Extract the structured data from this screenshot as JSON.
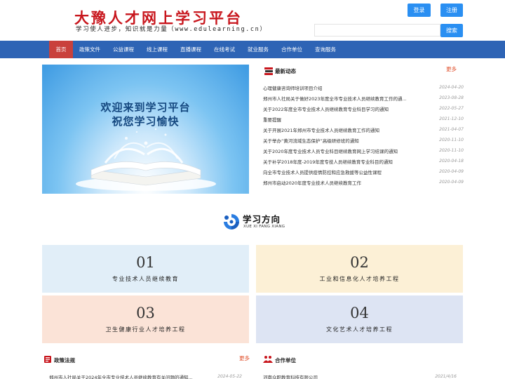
{
  "header": {
    "title": "大豫人才网上学习平台",
    "slogan": "学习使人进步，知识就是力量（www.edulearning.cn）",
    "login_label": "登录",
    "register_label": "注册",
    "search_placeholder": "",
    "search_label": "搜索"
  },
  "nav": {
    "items": [
      "首页",
      "政策文件",
      "公益课程",
      "线上课程",
      "直播课程",
      "在线考试",
      "就业服务",
      "合作单位",
      "查询服务"
    ],
    "active_index": 0
  },
  "banner": {
    "line1": "欢迎来到学习平台",
    "line2": "祝您学习愉快"
  },
  "news": {
    "title": "最新动态",
    "more_label": "更多",
    "items": [
      {
        "title": "心理健康咨询师培训项目介绍",
        "date": "2024-04-20"
      },
      {
        "title": "郑州市人社局关于做好2023年度全市专业技术人员继续教育工作的通...",
        "date": "2023-08-28"
      },
      {
        "title": "关于2022年度全市专业技术人员继续教育专业科目学习的通知",
        "date": "2022-05-27"
      },
      {
        "title": "重要提醒",
        "date": "2021-12-10"
      },
      {
        "title": "关于开展2021年郑州市专业技术人员继续教育工作的通知",
        "date": "2021-04-07"
      },
      {
        "title": "关于举办“黄河流域生态保护”高级研修班的通知",
        "date": "2020-11-10"
      },
      {
        "title": "关于2020年度专业技术人员专业科目继续教育网上学习结课的通知",
        "date": "2020-11-10"
      },
      {
        "title": "关于补学2018年度-2019年度专技人员继续教育专业科目的通知",
        "date": "2020-04-18"
      },
      {
        "title": "向全市专业技术人员提供疫情防控和应急救援等公益性课程",
        "date": "2020-04-09"
      },
      {
        "title": "郑州市启动2020年度专业技术人员继续教育工作",
        "date": "2020-04-09"
      }
    ]
  },
  "direction": {
    "title": "学习方向",
    "subtitle": "XUE XI FANG XIANG",
    "cards": [
      {
        "num": "01",
        "label": "专业技术人员继续教育",
        "color": "#e1eef8"
      },
      {
        "num": "02",
        "label": "工业和信息化人才培养工程",
        "color": "#fcf0d6"
      },
      {
        "num": "03",
        "label": "卫生健康行业人才培养工程",
        "color": "#fbe3d7"
      },
      {
        "num": "04",
        "label": "文化艺术人才培养工程",
        "color": "#dde4f3"
      }
    ]
  },
  "policy": {
    "title": "政策法规",
    "more_label": "更多",
    "items": [
      {
        "title": "郑州市人社局关于2024年全市专业技术人员继续教育有关问题的通知...",
        "date": "2024-05-22"
      }
    ]
  },
  "partners": {
    "title": "合作单位",
    "items": [
      {
        "title": "河南众职教育科技有限公司",
        "date": "2021/4/16"
      }
    ]
  },
  "colors": {
    "nav_bg": "#2e64b5",
    "nav_active": "#c9413c",
    "button_blue": "#2a8ff2",
    "title_red": "#c8161d",
    "more_orange": "#e0502c"
  }
}
